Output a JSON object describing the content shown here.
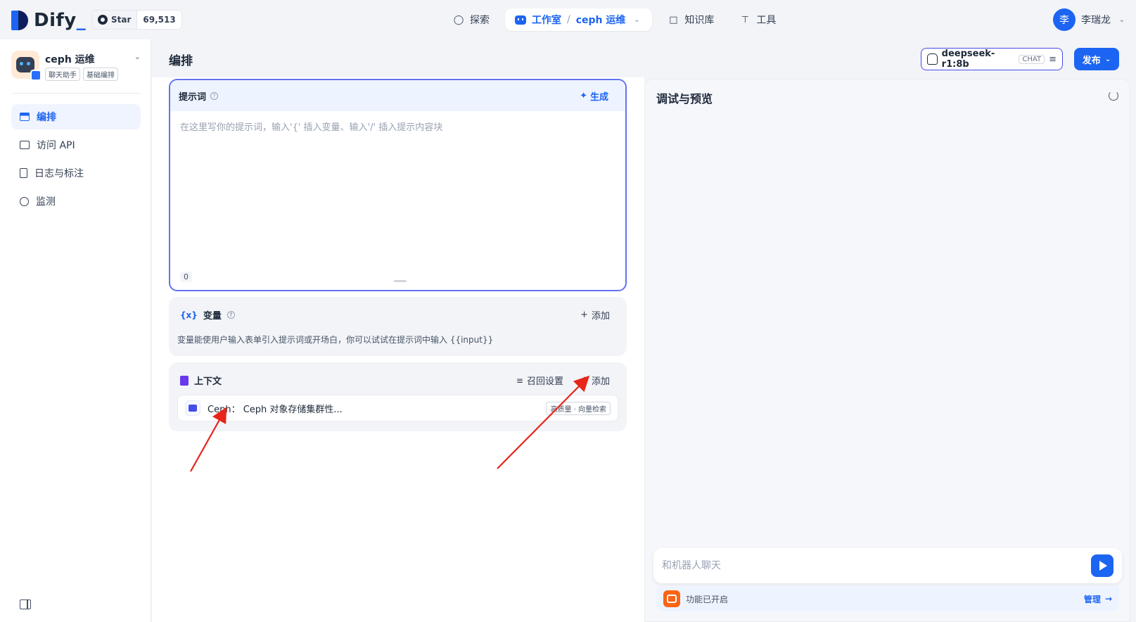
{
  "topbar": {
    "logo_text": "Dify",
    "star_label": "Star",
    "star_count": "69,513",
    "nav": {
      "explore": "探索",
      "studio": "工作室",
      "separator": "/",
      "current_app": "ceph 运维",
      "knowledge": "知识库",
      "tools": "工具"
    },
    "user": {
      "avatar_initial": "李",
      "name": "李瑞龙"
    }
  },
  "sidebar": {
    "app_name": "ceph 运维",
    "tags": [
      "聊天助手",
      "基础编排"
    ],
    "items": [
      {
        "label": "编排",
        "icon": "layout-icon",
        "active": true
      },
      {
        "label": "访问 API",
        "icon": "terminal-icon",
        "active": false
      },
      {
        "label": "日志与标注",
        "icon": "file-list-icon",
        "active": false
      },
      {
        "label": "监测",
        "icon": "gauge-icon",
        "active": false
      }
    ]
  },
  "main": {
    "title": "编排",
    "model": {
      "name": "deepseek-r1:8b",
      "mode": "CHAT"
    },
    "publish_label": "发布",
    "prompt": {
      "title": "提示词",
      "generate_label": "生成",
      "placeholder": "在这里写你的提示词，输入'{' 插入变量、输入'/' 插入提示内容块",
      "char_count": "0"
    },
    "variables": {
      "title": "变量",
      "add_label": "添加",
      "description": "变量能使用户输入表单引入提示词或开场白，你可以试试在提示词中输入 {{input}}"
    },
    "context": {
      "title": "上下文",
      "recall_label": "召回设置",
      "add_label": "添加",
      "items": [
        {
          "name": "Ceph： Ceph 对象存储集群性...",
          "badge": "高质量 · 向量检索"
        }
      ]
    }
  },
  "debug": {
    "title": "调试与预览",
    "chat_placeholder": "和机器人聊天",
    "feature_text": "功能已开启",
    "manage_label": "管理"
  },
  "colors": {
    "primary": "#1c64f2",
    "prompt_border": "#6172f3",
    "annotation_arrow": "#e8241b"
  }
}
